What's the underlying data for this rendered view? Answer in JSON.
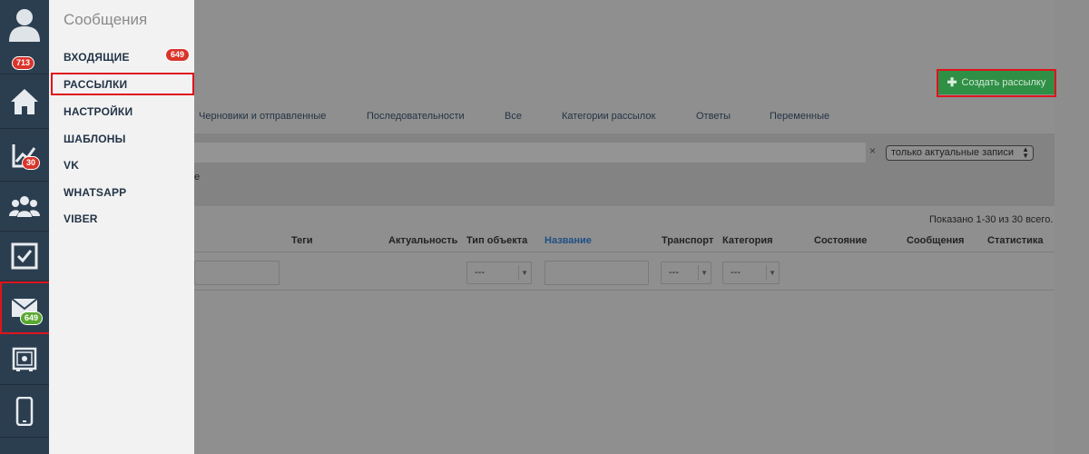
{
  "rail": {
    "profile_badge": "713",
    "analytics_badge": "30",
    "messages_badge": "649"
  },
  "submenu": {
    "title": "Сообщения",
    "inbox_count": "649",
    "items": [
      "ВХОДЯЩИЕ",
      "РАССЫЛКИ",
      "НАСТРОЙКИ",
      "ШАБЛОНЫ",
      "VK",
      "WHATSAPP",
      "VIBER"
    ]
  },
  "header": {
    "create_button": "Создать рассылку"
  },
  "tabs": [
    "Черновики и отправленные",
    "Последовательности",
    "Все",
    "Категории рассылок",
    "Ответы",
    "Переменные"
  ],
  "filters": {
    "clear_symbol": "×",
    "actuality_select": "только актуальные записи",
    "partial_label": "е"
  },
  "table": {
    "shown_text": "Показано 1-30 из 30 всего.",
    "columns": [
      "Теги",
      "Актуальность",
      "Тип объекта",
      "Название",
      "Транспорт",
      "Категория",
      "Состояние",
      "Сообщения",
      "Статистика"
    ],
    "select_placeholder": "---"
  },
  "colors": {
    "rail_bg": "#2b3e50",
    "accent_green": "#2f8f45",
    "badge_red": "#d9342b",
    "badge_green": "#5aa832",
    "highlight_red": "#e0141b"
  }
}
